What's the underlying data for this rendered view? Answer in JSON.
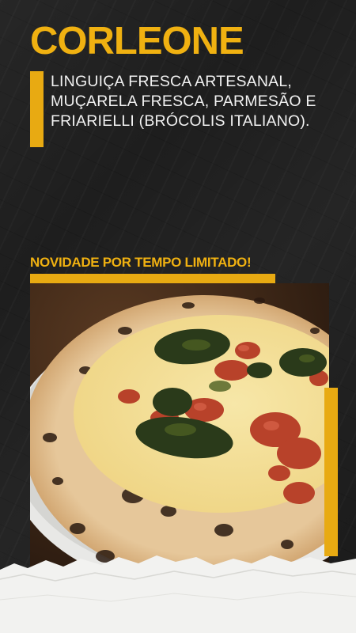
{
  "title": "CORLEONE",
  "description": "LINGUIÇA FRESCA ARTESANAL, MUÇARELA FRESCA, PARMESÃO E FRIARIELLI (BRÓCOLIS ITALIANO).",
  "promo": "NOVIDADE POR TEMPO LIMITADO!",
  "colors": {
    "accent": "#f0b111",
    "background": "#1e1e1e",
    "text": "#f2f2f2"
  }
}
